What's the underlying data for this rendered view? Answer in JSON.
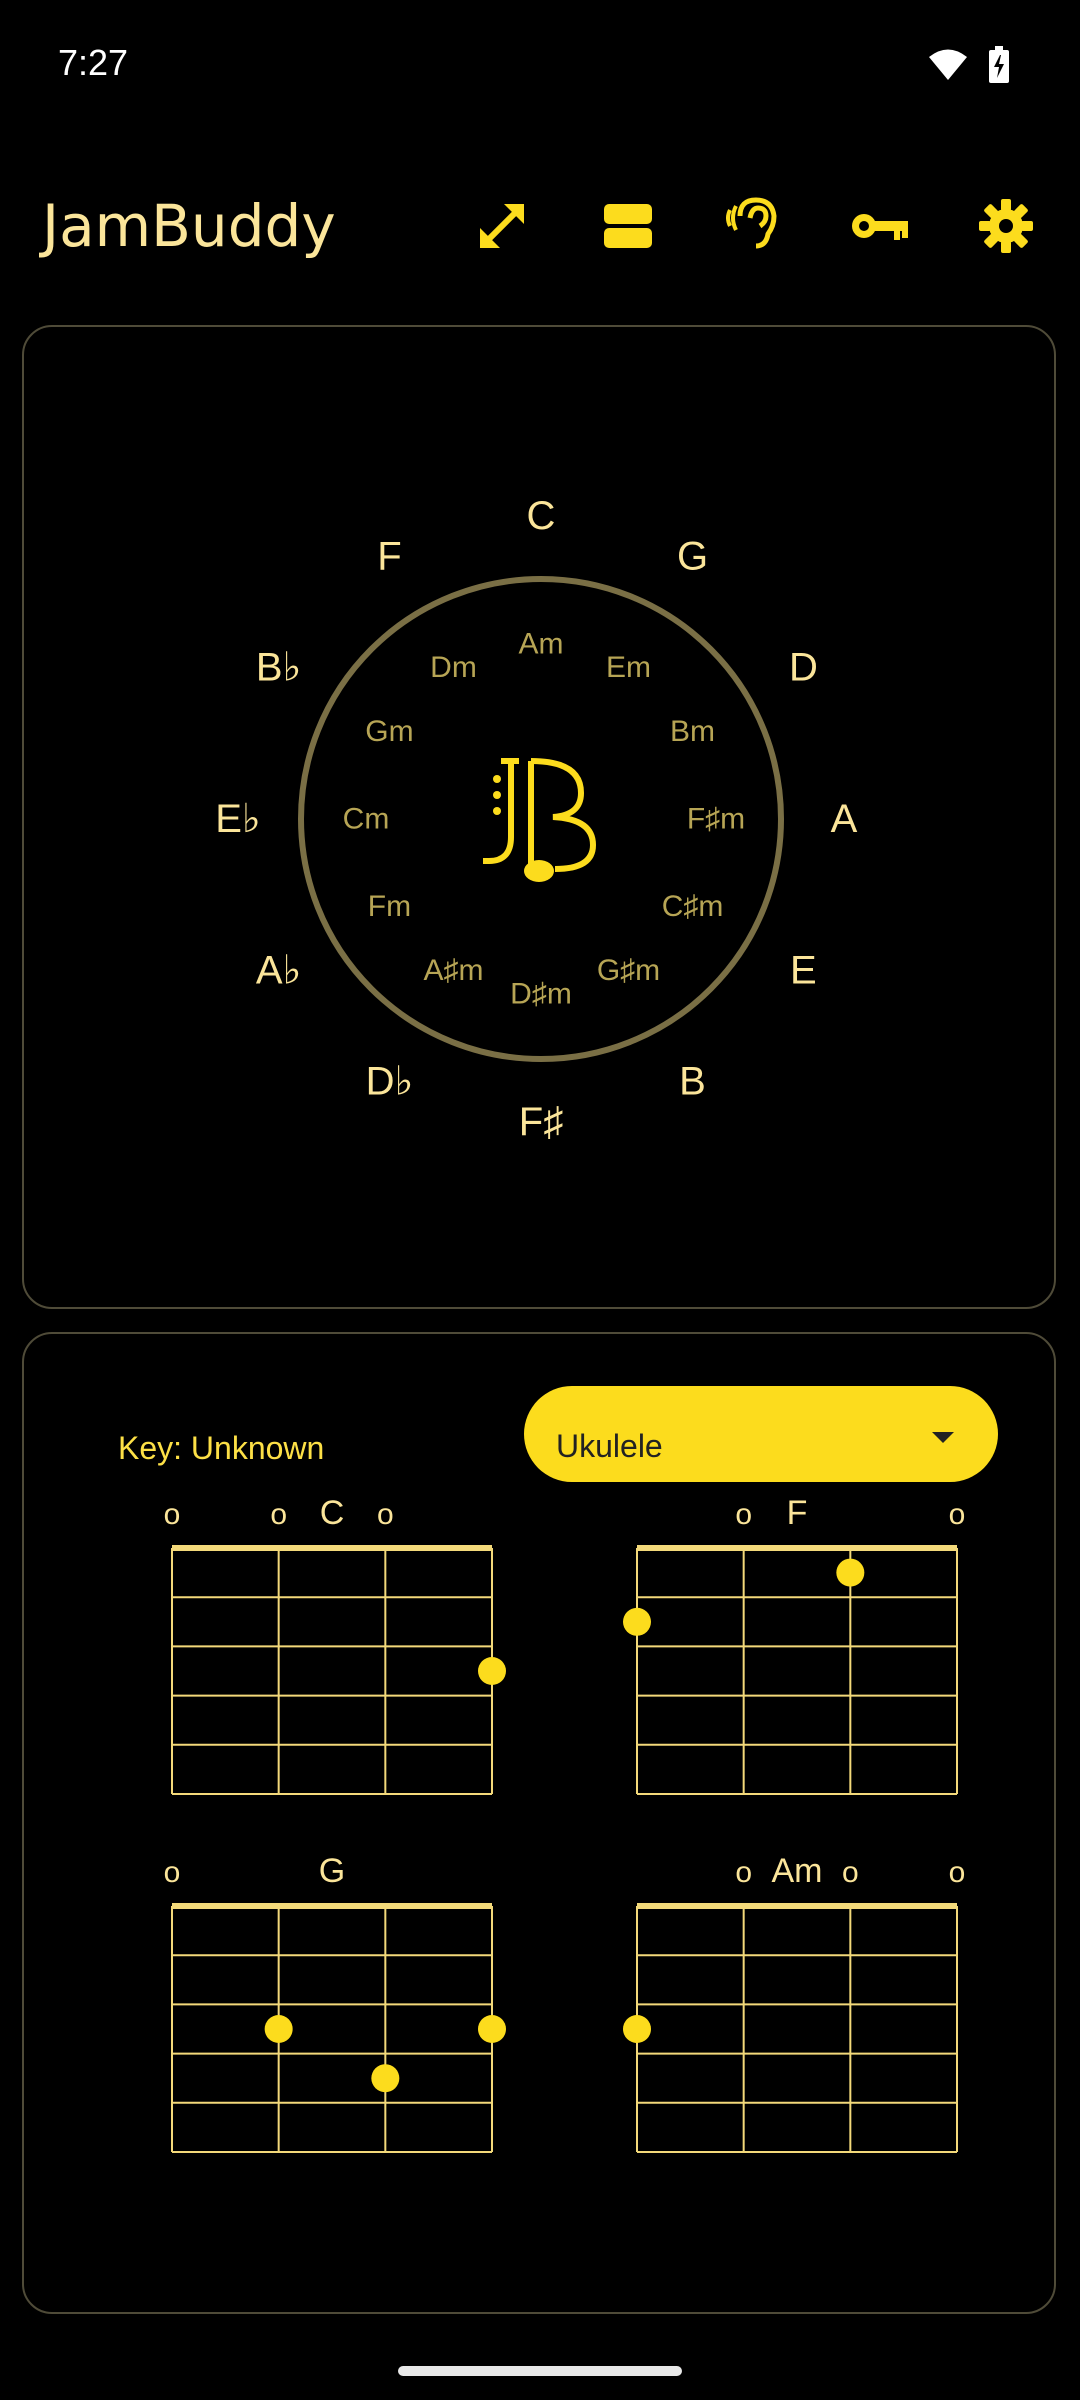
{
  "status_bar": {
    "time": "7:27",
    "icons": [
      "wifi-icon",
      "battery-charging-icon"
    ]
  },
  "app_bar": {
    "title": "JamBuddy",
    "actions": [
      "expand-icon",
      "layout-toggle-icon",
      "ear-icon",
      "key-icon",
      "gear-icon"
    ]
  },
  "circle_of_fifths": {
    "majors": [
      "C",
      "G",
      "D",
      "A",
      "E",
      "B",
      "F♯",
      "D♭",
      "A♭",
      "E♭",
      "B♭",
      "F"
    ],
    "minors": [
      "Am",
      "Em",
      "Bm",
      "F♯m",
      "C♯m",
      "G♯m",
      "D♯m",
      "A♯m",
      "Fm",
      "Cm",
      "Gm",
      "Dm"
    ],
    "logo": "JB"
  },
  "chords_panel": {
    "key_label": "Key: Unknown",
    "instrument": "Ukulele",
    "chords": [
      {
        "name": "C",
        "open_strings": [
          0,
          1,
          2
        ],
        "dots": [
          [
            3,
            3
          ]
        ]
      },
      {
        "name": "F",
        "open_strings": [
          1,
          3
        ],
        "dots": [
          [
            2,
            1
          ],
          [
            0,
            2
          ]
        ]
      },
      {
        "name": "G",
        "open_strings": [
          0
        ],
        "dots": [
          [
            1,
            3
          ],
          [
            3,
            3
          ],
          [
            2,
            4
          ]
        ]
      },
      {
        "name": "Am",
        "open_strings": [
          1,
          2,
          3
        ],
        "dots": [
          [
            0,
            3
          ]
        ]
      }
    ]
  },
  "colors": {
    "accent": "#fcdc1d",
    "text_light": "#fbe59a",
    "minor_text": "#b7a555",
    "ring": "#7a6f45",
    "card_border": "#4f4b38",
    "fret_line": "#f3d97a"
  }
}
